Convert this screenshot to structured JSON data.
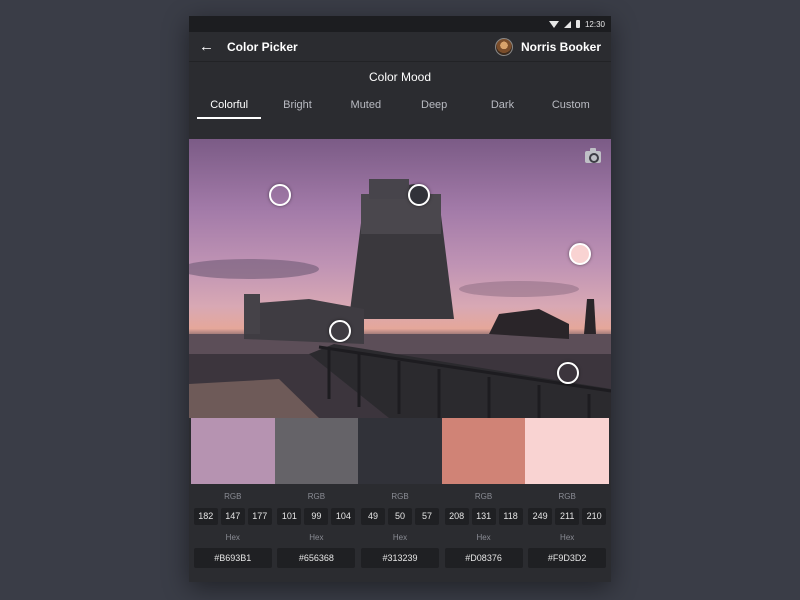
{
  "statusbar": {
    "time": "12:30"
  },
  "appbar": {
    "title": "Color Picker",
    "user_name": "Norris Booker"
  },
  "section_title": "Color Mood",
  "tabs": [
    {
      "label": "Colorful",
      "active": true
    },
    {
      "label": "Bright",
      "active": false
    },
    {
      "label": "Muted",
      "active": false
    },
    {
      "label": "Deep",
      "active": false
    },
    {
      "label": "Dark",
      "active": false
    },
    {
      "label": "Custom",
      "active": false
    }
  ],
  "swatches": [
    {
      "color": "#B693B1",
      "rgb_label": "RGB",
      "r": "182",
      "g": "147",
      "b": "177",
      "hex_label": "Hex",
      "hex": "#B693B1"
    },
    {
      "color": "#656368",
      "rgb_label": "RGB",
      "r": "101",
      "g": "99",
      "b": "104",
      "hex_label": "Hex",
      "hex": "#656368"
    },
    {
      "color": "#313239",
      "rgb_label": "RGB",
      "r": "49",
      "g": "50",
      "b": "57",
      "hex_label": "Hex",
      "hex": "#313239"
    },
    {
      "color": "#D08376",
      "rgb_label": "RGB",
      "r": "208",
      "g": "131",
      "b": "118",
      "hex_label": "Hex",
      "hex": "#D08376"
    },
    {
      "color": "#F9D3D2",
      "rgb_label": "RGB",
      "r": "249",
      "g": "211",
      "b": "210",
      "hex_label": "Hex",
      "hex": "#F9D3D2"
    }
  ]
}
